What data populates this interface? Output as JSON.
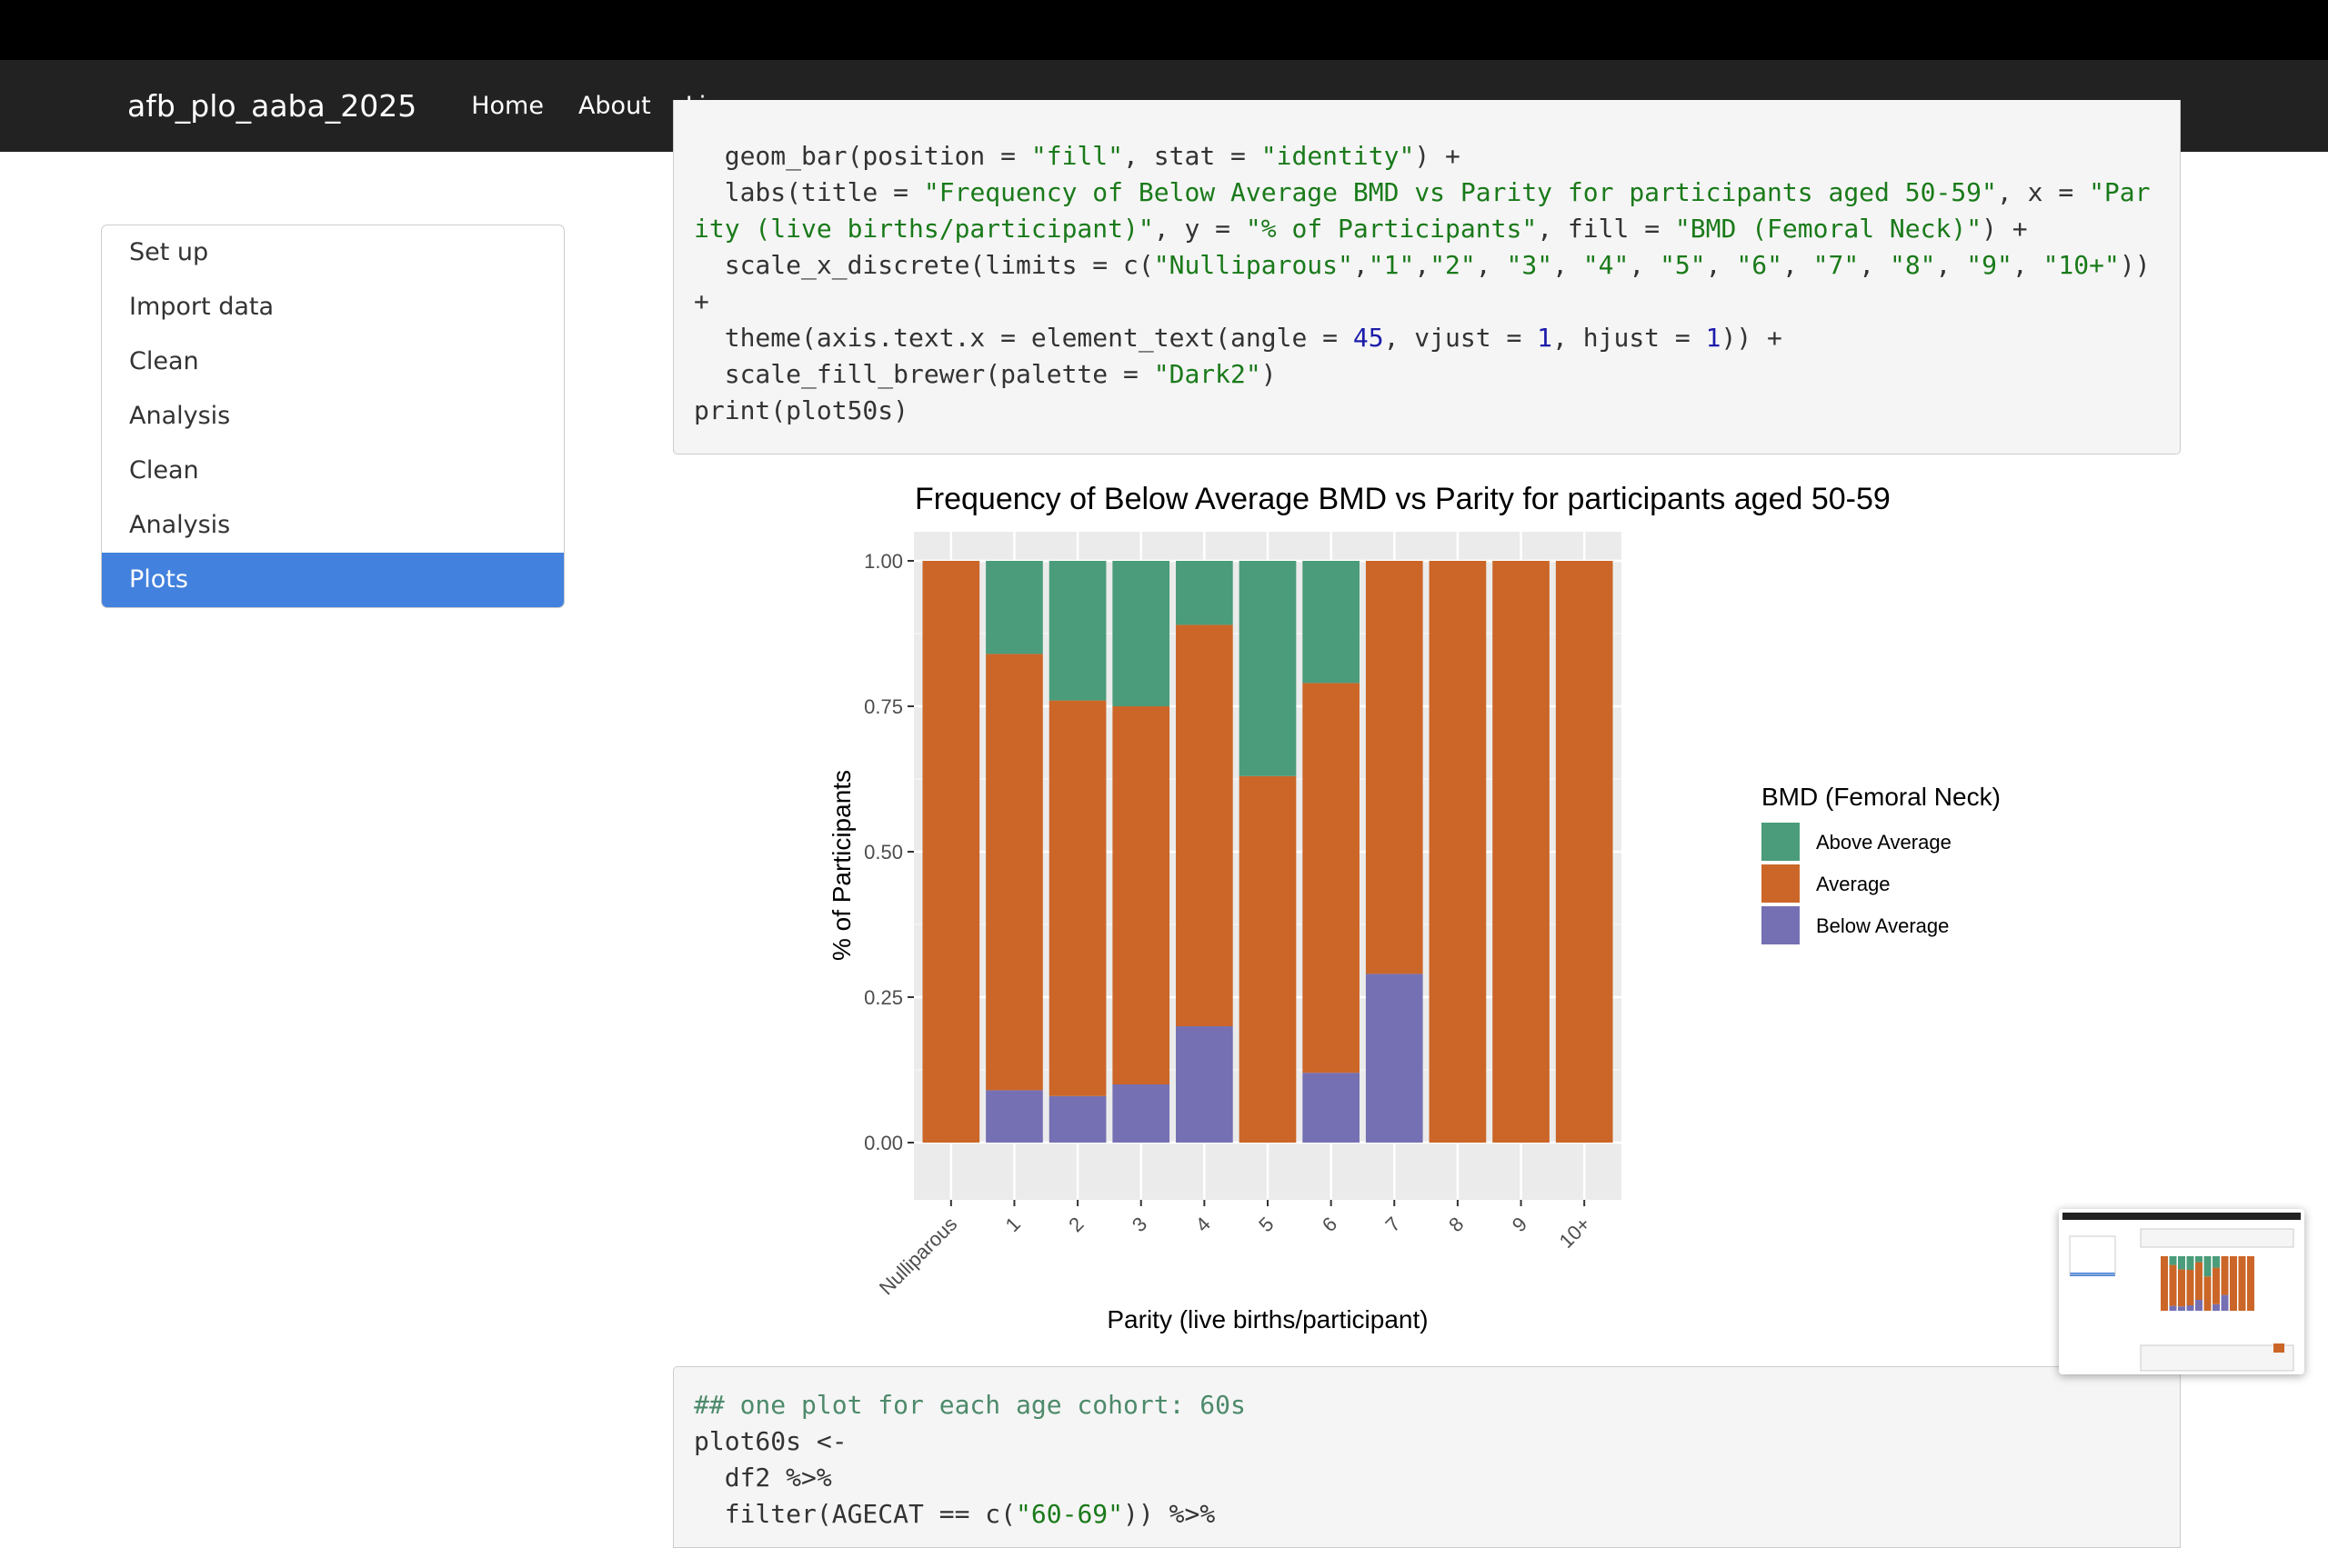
{
  "navbar": {
    "brand": "afb_plo_aaba_2025",
    "links": [
      "Home",
      "About",
      "License"
    ]
  },
  "toc": {
    "items": [
      "Set up",
      "Import data",
      "Clean",
      "Analysis",
      "Clean",
      "Analysis",
      "Plots"
    ],
    "active_index": 6,
    "active_color": "#4281dd"
  },
  "code_block_1": {
    "lines": [
      [
        {
          "t": "  geom_bar(position = ",
          "c": ""
        },
        {
          "t": "\"fill\"",
          "c": "str"
        },
        {
          "t": ", stat = ",
          "c": ""
        },
        {
          "t": "\"identity\"",
          "c": "str"
        },
        {
          "t": ") +",
          "c": ""
        }
      ],
      [
        {
          "t": "  labs(title = ",
          "c": ""
        },
        {
          "t": "\"Frequency of Below Average BMD vs Parity for participants aged 50-59\"",
          "c": "str"
        },
        {
          "t": ", x = ",
          "c": ""
        },
        {
          "t": "\"Par",
          "c": "str"
        }
      ],
      [
        {
          "t": "ity (live births/participant)\"",
          "c": "str"
        },
        {
          "t": ", y = ",
          "c": ""
        },
        {
          "t": "\"% of Participants\"",
          "c": "str"
        },
        {
          "t": ", fill = ",
          "c": ""
        },
        {
          "t": "\"BMD (Femoral Neck)\"",
          "c": "str"
        },
        {
          "t": ") +",
          "c": ""
        }
      ],
      [
        {
          "t": "  scale_x_discrete(limits = c(",
          "c": ""
        },
        {
          "t": "\"Nulliparous\"",
          "c": "str"
        },
        {
          "t": ",",
          "c": ""
        },
        {
          "t": "\"1\"",
          "c": "str"
        },
        {
          "t": ",",
          "c": ""
        },
        {
          "t": "\"2\"",
          "c": "str"
        },
        {
          "t": ", ",
          "c": ""
        },
        {
          "t": "\"3\"",
          "c": "str"
        },
        {
          "t": ", ",
          "c": ""
        },
        {
          "t": "\"4\"",
          "c": "str"
        },
        {
          "t": ", ",
          "c": ""
        },
        {
          "t": "\"5\"",
          "c": "str"
        },
        {
          "t": ", ",
          "c": ""
        },
        {
          "t": "\"6\"",
          "c": "str"
        },
        {
          "t": ", ",
          "c": ""
        },
        {
          "t": "\"7\"",
          "c": "str"
        },
        {
          "t": ", ",
          "c": ""
        },
        {
          "t": "\"8\"",
          "c": "str"
        },
        {
          "t": ", ",
          "c": ""
        },
        {
          "t": "\"9\"",
          "c": "str"
        },
        {
          "t": ", ",
          "c": ""
        },
        {
          "t": "\"10+\"",
          "c": "str"
        },
        {
          "t": "))",
          "c": ""
        }
      ],
      [
        {
          "t": "+",
          "c": ""
        }
      ],
      [
        {
          "t": "  theme(axis.text.x = element_text(angle = ",
          "c": ""
        },
        {
          "t": "45",
          "c": "num"
        },
        {
          "t": ", vjust = ",
          "c": ""
        },
        {
          "t": "1",
          "c": "num"
        },
        {
          "t": ", hjust = ",
          "c": ""
        },
        {
          "t": "1",
          "c": "num"
        },
        {
          "t": ")) +",
          "c": ""
        }
      ],
      [
        {
          "t": "  scale_fill_brewer(palette = ",
          "c": ""
        },
        {
          "t": "\"Dark2\"",
          "c": "str"
        },
        {
          "t": ")",
          "c": ""
        }
      ],
      [
        {
          "t": "print(plot50s)",
          "c": ""
        }
      ]
    ]
  },
  "code_block_2": {
    "lines": [
      [
        {
          "t": "## one plot for each age cohort: 60s",
          "c": "com"
        }
      ],
      [
        {
          "t": "plot60s <-",
          "c": ""
        }
      ],
      [
        {
          "t": "  df2 %>%",
          "c": ""
        }
      ],
      [
        {
          "t": "  filter(AGECAT == c(",
          "c": ""
        },
        {
          "t": "\"60-69\"",
          "c": "str"
        },
        {
          "t": ")) %>%",
          "c": ""
        }
      ]
    ]
  },
  "chart_data": {
    "type": "bar",
    "stacked": "fill",
    "title": "Frequency of Below Average BMD vs Parity for participants aged 50-59",
    "xlabel": "Parity (live births/participant)",
    "ylabel": "% of Participants",
    "ylim": [
      0,
      1
    ],
    "yticks": [
      "0.00",
      "0.25",
      "0.50",
      "0.75",
      "1.00"
    ],
    "categories": [
      "Nulliparous",
      "1",
      "2",
      "3",
      "4",
      "5",
      "6",
      "7",
      "8",
      "9",
      "10+"
    ],
    "legend_title": "BMD (Femoral Neck)",
    "legend_position": "right",
    "grid": true,
    "series": [
      {
        "name": "Above Average",
        "color": "#4a9c7a",
        "values": [
          0,
          0.16,
          0.24,
          0.25,
          0.11,
          0.37,
          0.21,
          0,
          0,
          0,
          0
        ]
      },
      {
        "name": "Average",
        "color": "#cb6628",
        "values": [
          1,
          0.75,
          0.68,
          0.65,
          0.69,
          0.63,
          0.67,
          0.71,
          1,
          1,
          1
        ]
      },
      {
        "name": "Below Average",
        "color": "#7570b3",
        "values": [
          0,
          0.09,
          0.08,
          0.1,
          0.2,
          0,
          0.12,
          0.29,
          0,
          0,
          0
        ]
      }
    ]
  }
}
